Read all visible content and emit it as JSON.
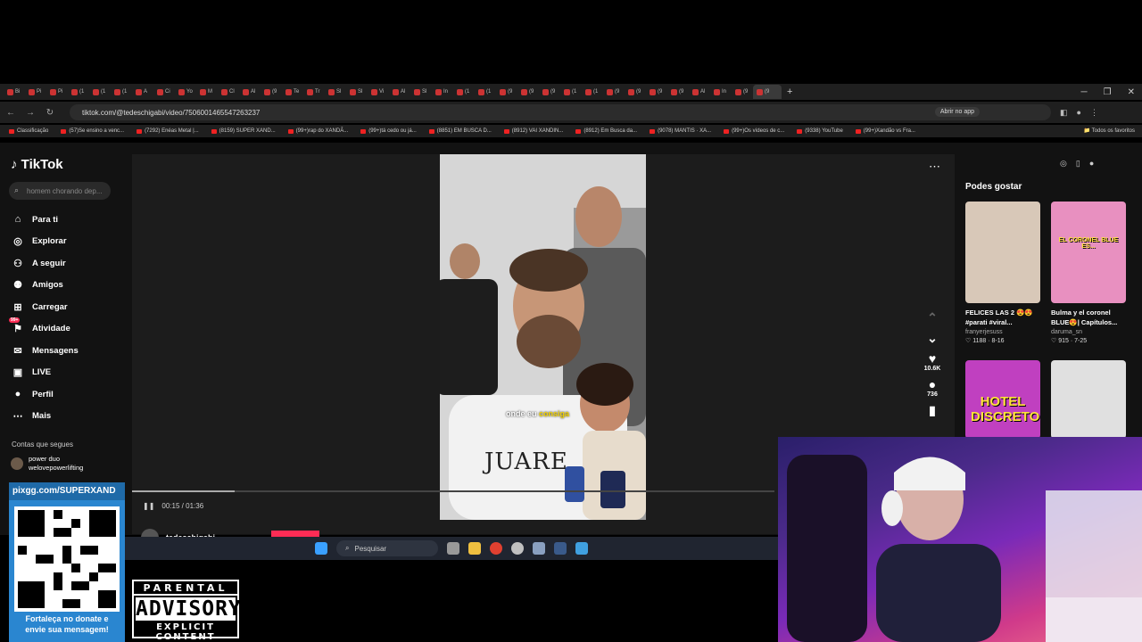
{
  "browser": {
    "url": "tiktok.com/@tedeschigabi/video/7506001465547263237",
    "open_in_app": "Abrir no app",
    "tabs": [
      "Bi",
      "Pi",
      "Pi",
      "(1",
      "(1",
      "(1",
      "A",
      "Ci",
      "Yo",
      "M",
      "Cl",
      "Al",
      "(9",
      "Te",
      "Tr",
      "Sl",
      "Sl",
      "Vi",
      "Al",
      "Sl",
      "In",
      "(1",
      "(1",
      "(9",
      "(9",
      "(9",
      "(1",
      "(1",
      "(9",
      "(9",
      "(9",
      "(9",
      "Al",
      "In",
      "(9",
      "(9"
    ],
    "new_tab": "+",
    "bookmarks": [
      "Classificação",
      "(57)Se ensino a venc...",
      "(7292) Enéas Metal |...",
      "(8159) SUPER XAND...",
      "(99+)rap do XANDÃ...",
      "(99+)tá cedo ou já...",
      "(8851) EM BUSCA D...",
      "(8912) VAI XANDIN...",
      "(8912) Em Busca da...",
      "(9078) MANTIS · XA...",
      "(99+)Os vídeos de c...",
      "(9338) YouTube",
      "(99+)Xandão vs Fra..."
    ],
    "bookmarks_right": "Todos os favoritos"
  },
  "tiktok": {
    "logo": "TikTok",
    "search_placeholder": "homem chorando dep...",
    "nav": [
      {
        "label": "Para ti",
        "icon": "home-icon"
      },
      {
        "label": "Explorar",
        "icon": "compass-icon"
      },
      {
        "label": "A seguir",
        "icon": "user-follow-icon"
      },
      {
        "label": "Amigos",
        "icon": "friends-icon"
      },
      {
        "label": "Carregar",
        "icon": "upload-icon"
      },
      {
        "label": "Atividade",
        "icon": "activity-icon",
        "badge": "99+"
      },
      {
        "label": "Mensagens",
        "icon": "messages-icon"
      },
      {
        "label": "LIVE",
        "icon": "live-icon"
      },
      {
        "label": "Perfil",
        "icon": "profile-icon"
      },
      {
        "label": "Mais",
        "icon": "more-icon"
      }
    ],
    "following_label": "Contas que segues",
    "following_account": {
      "line1": "power duo",
      "line2": "welovepowerlifting"
    },
    "video": {
      "caption": "onde eu",
      "caption_highlight": "consiga",
      "brand": "JUARE",
      "time_current": "00:15",
      "time_sep": "/",
      "time_total": "01:36",
      "progress": 0.16,
      "likes": "10.6K",
      "comments": "736",
      "author": "tedeschigabi"
    },
    "suggest_title": "Podes gostar",
    "suggestions": [
      {
        "title": "FELICES LAS 2 😍😍 #parati #viral...",
        "user": "franyerjesuss",
        "likes": "1188",
        "date": "8-16",
        "thumb_color": "#d8c8b8"
      },
      {
        "title": "Bulma y el coronel BLUE😍| Capítulos...",
        "user": "daruma_sn",
        "likes": "915",
        "date": "7-25",
        "thumb_color": "#e890c0",
        "overlay": "EL CORONEL BLUE ES..."
      },
      {
        "title": "",
        "user": "",
        "likes": "",
        "date": "",
        "thumb_color": "#c040c0",
        "overlay": "HOTEL DISCRETO"
      },
      {
        "title": "",
        "user": "",
        "likes": "",
        "date": "",
        "thumb_color": "#e0e0e0"
      }
    ]
  },
  "taskbar": {
    "search_placeholder": "Pesquisar"
  },
  "overlay": {
    "qr_header": "pixgg.com/SUPERXAND",
    "qr_footer_line1": "Fortaleça no donate e",
    "qr_footer_line2": "envie sua mensagem!",
    "parental_line1": "PARENTAL",
    "parental_line2": "ADVISORY",
    "parental_line3": "EXPLICIT CONTENT"
  }
}
